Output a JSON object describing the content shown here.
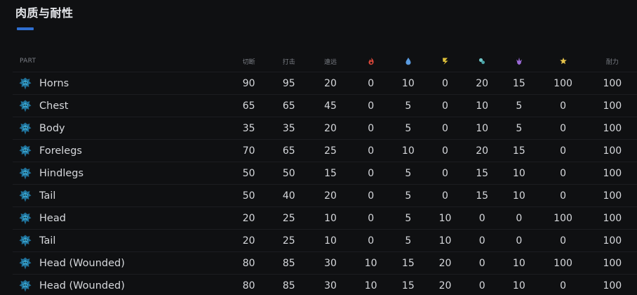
{
  "section": {
    "title": "肉质与耐性"
  },
  "table": {
    "headers": {
      "part": "PART",
      "cut": "切断",
      "impact": "打击",
      "shot": "遠远",
      "durability": "耐力"
    },
    "element_icons": [
      {
        "name": "fire-icon",
        "color": "#d9473a"
      },
      {
        "name": "water-icon",
        "color": "#5a9be0"
      },
      {
        "name": "thunder-icon",
        "color": "#e0c23a"
      },
      {
        "name": "ice-icon",
        "color": "#6fc4c6"
      },
      {
        "name": "dragon-icon",
        "color": "#9c6ad8"
      },
      {
        "name": "stun-icon",
        "color": "#e6c34a"
      }
    ],
    "rows": [
      {
        "part": "Horns",
        "v": [
          "90",
          "95",
          "20",
          "0",
          "10",
          "0",
          "20",
          "15",
          "100",
          "100"
        ]
      },
      {
        "part": "Chest",
        "v": [
          "65",
          "65",
          "45",
          "0",
          "5",
          "0",
          "10",
          "5",
          "0",
          "100"
        ]
      },
      {
        "part": "Body",
        "v": [
          "35",
          "35",
          "20",
          "0",
          "5",
          "0",
          "10",
          "5",
          "0",
          "100"
        ]
      },
      {
        "part": "Forelegs",
        "v": [
          "70",
          "65",
          "25",
          "0",
          "10",
          "0",
          "20",
          "15",
          "0",
          "100"
        ]
      },
      {
        "part": "Hindlegs",
        "v": [
          "50",
          "50",
          "15",
          "0",
          "5",
          "0",
          "15",
          "10",
          "0",
          "100"
        ]
      },
      {
        "part": "Tail",
        "v": [
          "50",
          "40",
          "20",
          "0",
          "5",
          "0",
          "15",
          "10",
          "0",
          "100"
        ]
      },
      {
        "part": "Head",
        "v": [
          "20",
          "25",
          "10",
          "0",
          "5",
          "10",
          "0",
          "0",
          "100",
          "100"
        ]
      },
      {
        "part": "Tail",
        "v": [
          "20",
          "25",
          "10",
          "0",
          "5",
          "10",
          "0",
          "0",
          "0",
          "100"
        ]
      },
      {
        "part": "Head (Wounded)",
        "v": [
          "80",
          "85",
          "30",
          "10",
          "15",
          "20",
          "0",
          "10",
          "100",
          "100"
        ]
      },
      {
        "part": "Head (Wounded)",
        "v": [
          "80",
          "85",
          "30",
          "10",
          "15",
          "20",
          "0",
          "10",
          "0",
          "100"
        ]
      }
    ]
  }
}
